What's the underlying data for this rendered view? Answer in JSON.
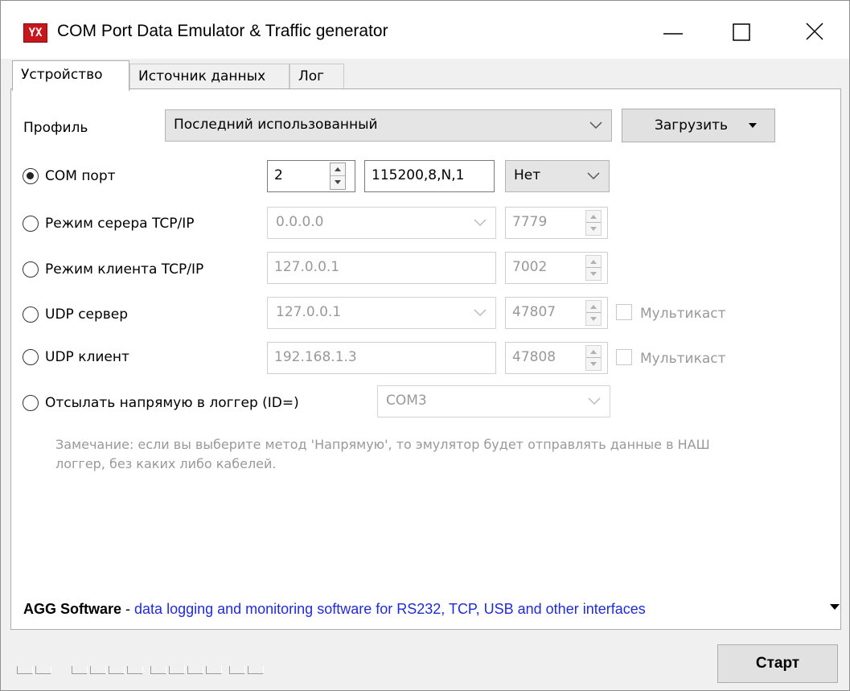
{
  "window": {
    "title": "COM Port Data Emulator & Traffic generator",
    "icon": "app-icon",
    "icon_text": "YX"
  },
  "tabs": [
    {
      "label": "Устройство",
      "active": true
    },
    {
      "label": "Источник данных",
      "active": false
    },
    {
      "label": "Лог",
      "active": false
    }
  ],
  "profile": {
    "label": "Профиль",
    "selected": "Последний использованный",
    "load_button": "Загрузить"
  },
  "modes": {
    "com_port": {
      "label": "COM порт",
      "selected": true,
      "port": "2",
      "settings": "115200,8,N,1",
      "flow": "Нет"
    },
    "tcp_server": {
      "label": "Режим серера TCP/IP",
      "selected": false,
      "address": "0.0.0.0",
      "port": "7779"
    },
    "tcp_client": {
      "label": "Режим клиента TCP/IP",
      "selected": false,
      "address": "127.0.0.1",
      "port": "7002"
    },
    "udp_server": {
      "label": "UDP сервер",
      "selected": false,
      "address": "127.0.0.1",
      "port": "47807",
      "multicast_label": "Мультикаст",
      "multicast": false
    },
    "udp_client": {
      "label": "UDP клиент",
      "selected": false,
      "address": "192.168.1.3",
      "port": "47808",
      "multicast_label": "Мультикаст",
      "multicast": false
    },
    "direct": {
      "label": "Отсылать напрямую в логгер (ID=)",
      "selected": false,
      "target": "COM3"
    }
  },
  "note": "Замечание: если вы выберите метод 'Напрямую', то эмулятор будет отправлять данные в НАШ логгер, без каких либо кабелей.",
  "footer": {
    "brand": "AGG Software",
    "separator": " - ",
    "description": "data logging and monitoring software for RS232, TCP, USB and other interfaces"
  },
  "start_button": "Старт",
  "colors": {
    "link": "#1f2bd6",
    "disabled_text": "#999999",
    "icon_red": "#c7171d"
  }
}
